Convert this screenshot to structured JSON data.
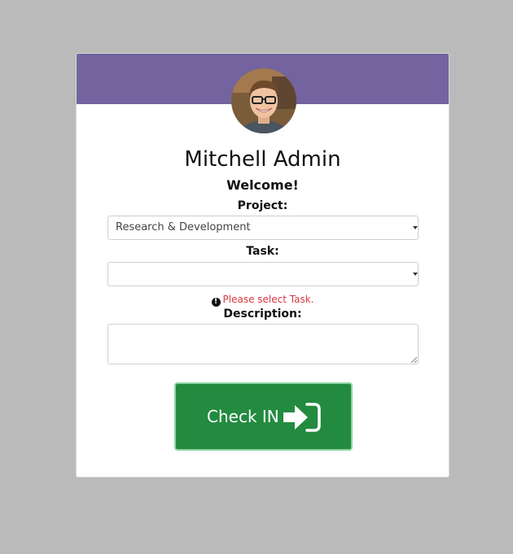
{
  "user": {
    "name": "Mitchell Admin",
    "greeting": "Welcome!"
  },
  "form": {
    "project": {
      "label": "Project:",
      "value": "Research & Development"
    },
    "task": {
      "label": "Task:",
      "value": "",
      "error": "Please select Task."
    },
    "description": {
      "label": "Description:",
      "value": ""
    }
  },
  "action": {
    "label": "Check IN",
    "icon": "sign-in-icon"
  },
  "colors": {
    "header": "#73649f",
    "button": "#228b3f",
    "error": "#d9363e",
    "background": "#b9bab9"
  }
}
